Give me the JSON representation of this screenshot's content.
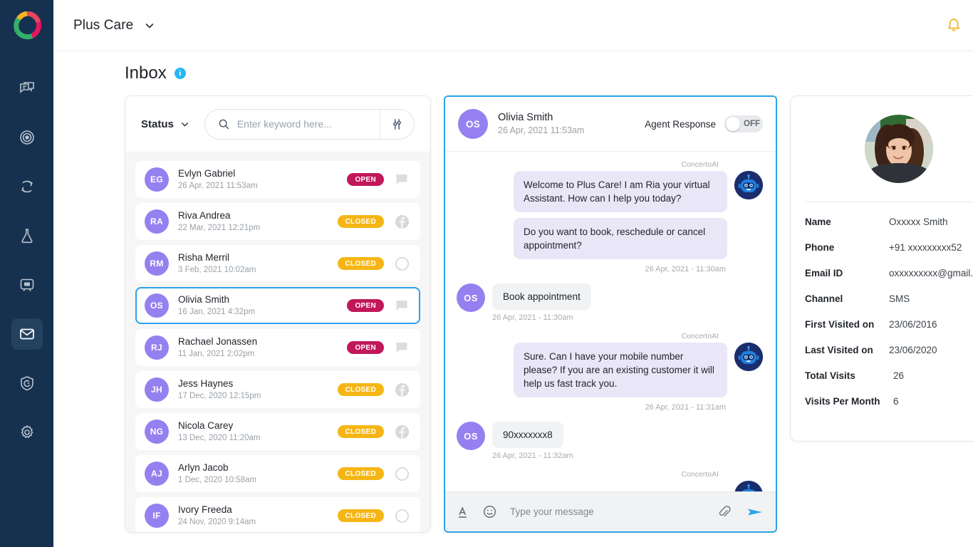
{
  "header": {
    "brand": "Plus Care",
    "caret_icon": "chevron-down-icon",
    "bell_icon": "bell-icon",
    "avatar_icon": "user-avatar"
  },
  "page": {
    "title": "Inbox",
    "info_icon": "info-icon"
  },
  "sidebar": {
    "logo_icon": "concerto-logo",
    "items": [
      {
        "icon": "chat-bubbles-icon",
        "name": "conversations",
        "active": false
      },
      {
        "icon": "target-icon",
        "name": "campaigns",
        "active": false
      },
      {
        "icon": "sync-icon",
        "name": "automation",
        "active": false
      },
      {
        "icon": "flask-icon",
        "name": "experiments",
        "active": false
      },
      {
        "icon": "display-chat-icon",
        "name": "widgets",
        "active": false
      },
      {
        "icon": "mail-icon",
        "name": "inbox",
        "active": true
      },
      {
        "icon": "shield-g-icon",
        "name": "guard",
        "active": false
      },
      {
        "icon": "gear-icon",
        "name": "settings",
        "active": false
      }
    ]
  },
  "list": {
    "status_label": "Status",
    "status_caret_icon": "chevron-down-icon",
    "search_placeholder": "Enter keyword here...",
    "search_value": "",
    "search_icon": "search-icon",
    "filter_icon": "sliders-icon",
    "rows": [
      {
        "initials": "EG",
        "name": "Evlyn Gabriel",
        "time": "26 Apr, 2021 11:53am",
        "status": "OPEN",
        "channel": "chat",
        "selected": false
      },
      {
        "initials": "RA",
        "name": "Riva Andrea",
        "time": "22 Mar, 2021 12:21pm",
        "status": "CLOSED",
        "channel": "facebook",
        "selected": false
      },
      {
        "initials": "RM",
        "name": "Risha Merril",
        "time": "3 Feb, 2021 10:02am",
        "status": "CLOSED",
        "channel": "circle",
        "selected": false
      },
      {
        "initials": "OS",
        "name": "Olivia Smith",
        "time": "16 Jan, 2021 4:32pm",
        "status": "OPEN",
        "channel": "chat",
        "selected": true
      },
      {
        "initials": "RJ",
        "name": "Rachael Jonassen",
        "time": "11 Jan, 2021 2:02pm",
        "status": "OPEN",
        "channel": "chat",
        "selected": false
      },
      {
        "initials": "JH",
        "name": "Jess Haynes",
        "time": "17 Dec, 2020 12:15pm",
        "status": "CLOSED",
        "channel": "facebook",
        "selected": false
      },
      {
        "initials": "NG",
        "name": "Nicola Carey",
        "time": "13 Dec, 2020 11:20am",
        "status": "CLOSED",
        "channel": "facebook",
        "selected": false
      },
      {
        "initials": "AJ",
        "name": "Arlyn Jacob",
        "time": "1 Dec, 2020 10:58am",
        "status": "CLOSED",
        "channel": "circle",
        "selected": false
      },
      {
        "initials": "IF",
        "name": "Ivory Freeda",
        "time": "24 Nov, 2020 9:14am",
        "status": "CLOSED",
        "channel": "circle",
        "selected": false
      }
    ]
  },
  "chat": {
    "initials": "OS",
    "contact_name": "Olivia Smith",
    "contact_time": "26 Apr, 2021 11:53am",
    "agent_response_label": "Agent Response",
    "agent_response_state": "OFF",
    "bot_name": "ConcertoAI",
    "bot_avatar_icon": "robot-icon",
    "messages": [
      {
        "sender": "bot",
        "label": "ConcertoAI",
        "bubbles": [
          "Welcome to Plus Care! I am Ria your virtual Assistant. How can I help you today?",
          "Do you want to book, reschedule or cancel appointment?"
        ],
        "time": "26 Apr, 2021 - 11:30am"
      },
      {
        "sender": "user",
        "initials": "OS",
        "bubbles": [
          "Book appointment"
        ],
        "time": "26 Apr, 2021 - 11:30am"
      },
      {
        "sender": "bot",
        "label": "ConcertoAI",
        "bubbles": [
          "Sure. Can I have your mobile number please? If you are an existing customer it will help us fast track you."
        ],
        "time": "26 Apr, 2021 - 11:31am"
      },
      {
        "sender": "user",
        "initials": "OS",
        "bubbles": [
          "90xxxxxxx8"
        ],
        "time": "26 Apr, 2021 - 11:32am"
      },
      {
        "sender": "bot",
        "label": "ConcertoAI",
        "bubbles": [],
        "time": ""
      }
    ],
    "composer": {
      "format_icon": "text-format-icon",
      "emoji_icon": "emoji-icon",
      "placeholder": "Type your message",
      "value": "",
      "attach_icon": "paperclip-icon",
      "send_icon": "send-icon"
    }
  },
  "profile": {
    "photo_icon": "contact-photo",
    "fields": [
      {
        "label": "Name",
        "value": "Oxxxxx Smith"
      },
      {
        "label": "Phone",
        "value": "+91 xxxxxxxxx52"
      },
      {
        "label": "Email ID",
        "value": "oxxxxxxxxx@gmail.com"
      },
      {
        "label": "Channel",
        "value": "SMS"
      },
      {
        "label": "First Visited on",
        "value": "23/06/2016"
      },
      {
        "label": "Last Visited on",
        "value": "23/06/2020"
      },
      {
        "label": "Total Visits",
        "value": "26"
      },
      {
        "label": "Visits Per Month",
        "value": "6"
      }
    ]
  },
  "colors": {
    "rail_bg": "#16314f",
    "accent_blue": "#2aa3e8",
    "open_badge": "#c2185b",
    "closed_badge": "#f5b615",
    "avatar_purple": "#9580f0",
    "bot_bubble": "#e9e6f8",
    "user_bubble": "#f1f2f3",
    "bell_amber": "#f2b01e"
  }
}
